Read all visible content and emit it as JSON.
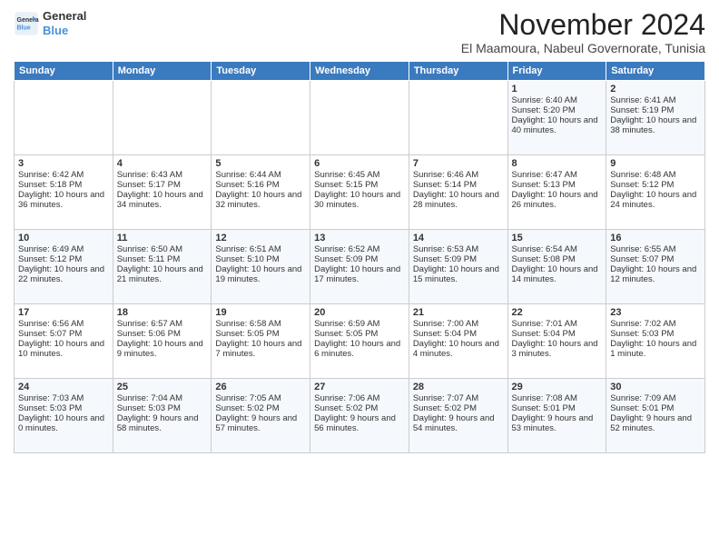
{
  "logo": {
    "line1": "General",
    "line2": "Blue"
  },
  "title": "November 2024",
  "subtitle": "El Maamoura, Nabeul Governorate, Tunisia",
  "days_header": [
    "Sunday",
    "Monday",
    "Tuesday",
    "Wednesday",
    "Thursday",
    "Friday",
    "Saturday"
  ],
  "weeks": [
    [
      {
        "day": "",
        "empty": true
      },
      {
        "day": "",
        "empty": true
      },
      {
        "day": "",
        "empty": true
      },
      {
        "day": "",
        "empty": true
      },
      {
        "day": "",
        "empty": true
      },
      {
        "day": "1",
        "sunrise": "6:40 AM",
        "sunset": "5:20 PM",
        "daylight": "10 hours and 40 minutes."
      },
      {
        "day": "2",
        "sunrise": "6:41 AM",
        "sunset": "5:19 PM",
        "daylight": "10 hours and 38 minutes."
      }
    ],
    [
      {
        "day": "3",
        "sunrise": "6:42 AM",
        "sunset": "5:18 PM",
        "daylight": "10 hours and 36 minutes."
      },
      {
        "day": "4",
        "sunrise": "6:43 AM",
        "sunset": "5:17 PM",
        "daylight": "10 hours and 34 minutes."
      },
      {
        "day": "5",
        "sunrise": "6:44 AM",
        "sunset": "5:16 PM",
        "daylight": "10 hours and 32 minutes."
      },
      {
        "day": "6",
        "sunrise": "6:45 AM",
        "sunset": "5:15 PM",
        "daylight": "10 hours and 30 minutes."
      },
      {
        "day": "7",
        "sunrise": "6:46 AM",
        "sunset": "5:14 PM",
        "daylight": "10 hours and 28 minutes."
      },
      {
        "day": "8",
        "sunrise": "6:47 AM",
        "sunset": "5:13 PM",
        "daylight": "10 hours and 26 minutes."
      },
      {
        "day": "9",
        "sunrise": "6:48 AM",
        "sunset": "5:12 PM",
        "daylight": "10 hours and 24 minutes."
      }
    ],
    [
      {
        "day": "10",
        "sunrise": "6:49 AM",
        "sunset": "5:12 PM",
        "daylight": "10 hours and 22 minutes."
      },
      {
        "day": "11",
        "sunrise": "6:50 AM",
        "sunset": "5:11 PM",
        "daylight": "10 hours and 21 minutes."
      },
      {
        "day": "12",
        "sunrise": "6:51 AM",
        "sunset": "5:10 PM",
        "daylight": "10 hours and 19 minutes."
      },
      {
        "day": "13",
        "sunrise": "6:52 AM",
        "sunset": "5:09 PM",
        "daylight": "10 hours and 17 minutes."
      },
      {
        "day": "14",
        "sunrise": "6:53 AM",
        "sunset": "5:09 PM",
        "daylight": "10 hours and 15 minutes."
      },
      {
        "day": "15",
        "sunrise": "6:54 AM",
        "sunset": "5:08 PM",
        "daylight": "10 hours and 14 minutes."
      },
      {
        "day": "16",
        "sunrise": "6:55 AM",
        "sunset": "5:07 PM",
        "daylight": "10 hours and 12 minutes."
      }
    ],
    [
      {
        "day": "17",
        "sunrise": "6:56 AM",
        "sunset": "5:07 PM",
        "daylight": "10 hours and 10 minutes."
      },
      {
        "day": "18",
        "sunrise": "6:57 AM",
        "sunset": "5:06 PM",
        "daylight": "10 hours and 9 minutes."
      },
      {
        "day": "19",
        "sunrise": "6:58 AM",
        "sunset": "5:05 PM",
        "daylight": "10 hours and 7 minutes."
      },
      {
        "day": "20",
        "sunrise": "6:59 AM",
        "sunset": "5:05 PM",
        "daylight": "10 hours and 6 minutes."
      },
      {
        "day": "21",
        "sunrise": "7:00 AM",
        "sunset": "5:04 PM",
        "daylight": "10 hours and 4 minutes."
      },
      {
        "day": "22",
        "sunrise": "7:01 AM",
        "sunset": "5:04 PM",
        "daylight": "10 hours and 3 minutes."
      },
      {
        "day": "23",
        "sunrise": "7:02 AM",
        "sunset": "5:03 PM",
        "daylight": "10 hours and 1 minute."
      }
    ],
    [
      {
        "day": "24",
        "sunrise": "7:03 AM",
        "sunset": "5:03 PM",
        "daylight": "10 hours and 0 minutes."
      },
      {
        "day": "25",
        "sunrise": "7:04 AM",
        "sunset": "5:03 PM",
        "daylight": "9 hours and 58 minutes."
      },
      {
        "day": "26",
        "sunrise": "7:05 AM",
        "sunset": "5:02 PM",
        "daylight": "9 hours and 57 minutes."
      },
      {
        "day": "27",
        "sunrise": "7:06 AM",
        "sunset": "5:02 PM",
        "daylight": "9 hours and 56 minutes."
      },
      {
        "day": "28",
        "sunrise": "7:07 AM",
        "sunset": "5:02 PM",
        "daylight": "9 hours and 54 minutes."
      },
      {
        "day": "29",
        "sunrise": "7:08 AM",
        "sunset": "5:01 PM",
        "daylight": "9 hours and 53 minutes."
      },
      {
        "day": "30",
        "sunrise": "7:09 AM",
        "sunset": "5:01 PM",
        "daylight": "9 hours and 52 minutes."
      }
    ]
  ]
}
